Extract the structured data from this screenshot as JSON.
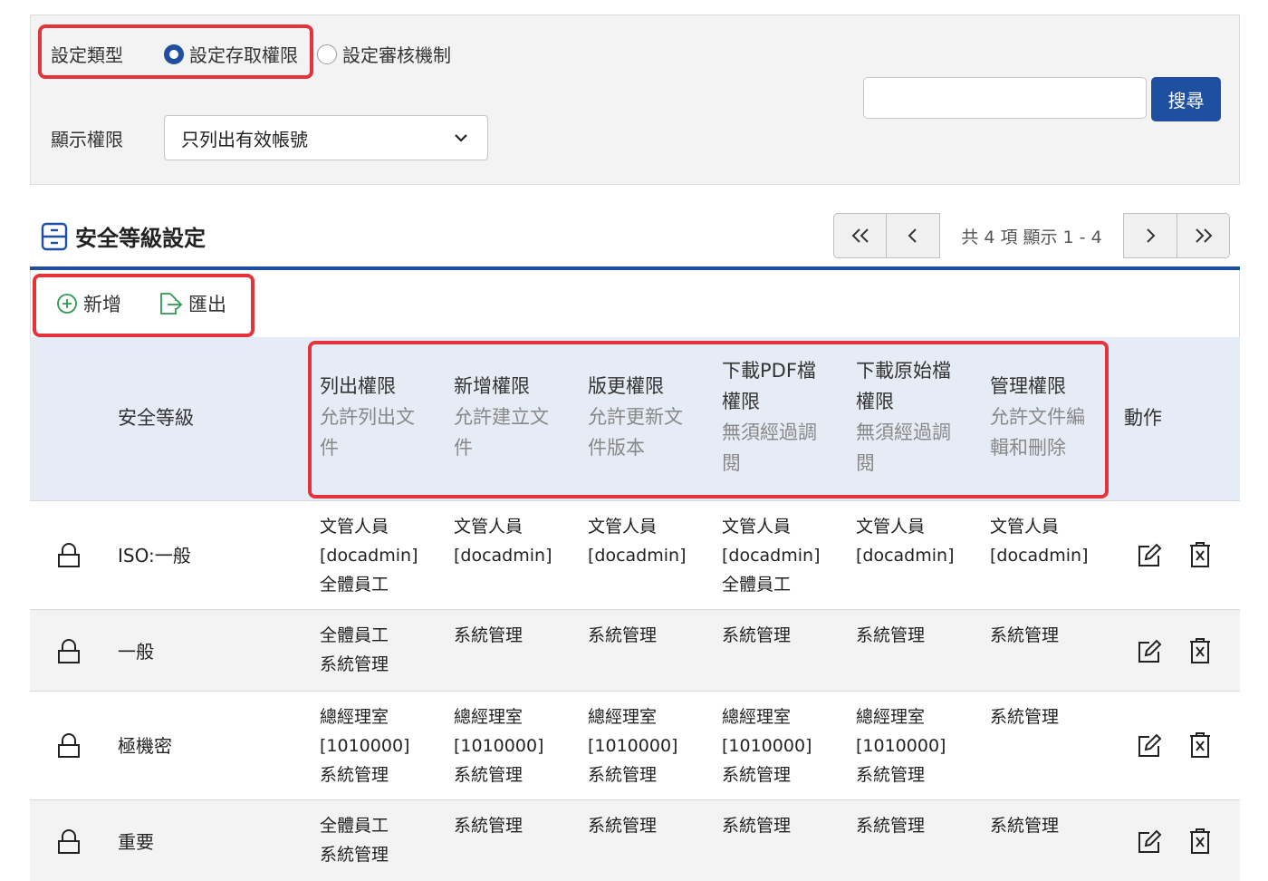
{
  "filter": {
    "setting_type_label": "設定類型",
    "radio_access": "設定存取權限",
    "radio_review": "設定審核機制",
    "display_label": "顯示權限",
    "display_value": "只列出有效帳號",
    "search_value": "",
    "search_button": "搜尋"
  },
  "section": {
    "title": "安全等級設定",
    "pager_info": "共 4 項 顯示 1 - 4"
  },
  "toolbar": {
    "add_label": "新增",
    "export_label": "匯出"
  },
  "table": {
    "headers": {
      "level": "安全等級",
      "action": "動作",
      "perms": [
        {
          "title_lines": [
            "列出權限"
          ],
          "sub_lines": [
            "允許列出文",
            "件"
          ]
        },
        {
          "title_lines": [
            "新增權限"
          ],
          "sub_lines": [
            "允許建立文",
            "件"
          ]
        },
        {
          "title_lines": [
            "版更權限"
          ],
          "sub_lines": [
            "允許更新文",
            "件版本"
          ]
        },
        {
          "title_lines": [
            "下載PDF檔",
            "權限"
          ],
          "sub_lines": [
            "無須經過調",
            "閱"
          ]
        },
        {
          "title_lines": [
            "下載原始檔",
            "權限"
          ],
          "sub_lines": [
            "無須經過調",
            "閱"
          ]
        },
        {
          "title_lines": [
            "管理權限"
          ],
          "sub_lines": [
            "允許文件編",
            "輯和刪除"
          ]
        }
      ]
    },
    "rows": [
      {
        "name": "ISO:一般",
        "perms": [
          [
            "文管人員",
            "[docadmin]",
            "全體員工"
          ],
          [
            "文管人員",
            "[docadmin]"
          ],
          [
            "文管人員",
            "[docadmin]"
          ],
          [
            "文管人員",
            "[docadmin]",
            "全體員工"
          ],
          [
            "文管人員",
            "[docadmin]"
          ],
          [
            "文管人員",
            "[docadmin]"
          ]
        ]
      },
      {
        "name": "一般",
        "perms": [
          [
            "全體員工",
            "系統管理"
          ],
          [
            "系統管理"
          ],
          [
            "系統管理"
          ],
          [
            "系統管理"
          ],
          [
            "系統管理"
          ],
          [
            "系統管理"
          ]
        ]
      },
      {
        "name": "極機密",
        "perms": [
          [
            "總經理室",
            "[1010000]",
            "系統管理"
          ],
          [
            "總經理室",
            "[1010000]",
            "系統管理"
          ],
          [
            "總經理室",
            "[1010000]",
            "系統管理"
          ],
          [
            "總經理室",
            "[1010000]",
            "系統管理"
          ],
          [
            "總經理室",
            "[1010000]",
            "系統管理"
          ],
          [
            "系統管理"
          ]
        ]
      },
      {
        "name": "重要",
        "perms": [
          [
            "全體員工",
            "系統管理"
          ],
          [
            "系統管理"
          ],
          [
            "系統管理"
          ],
          [
            "系統管理"
          ],
          [
            "系統管理"
          ],
          [
            "系統管理"
          ]
        ]
      }
    ]
  },
  "colors": {
    "primary": "#1f4fa1",
    "highlight": "#e5333c",
    "header_bg": "#e6ecf6",
    "add_icon": "#2e9a4f"
  }
}
